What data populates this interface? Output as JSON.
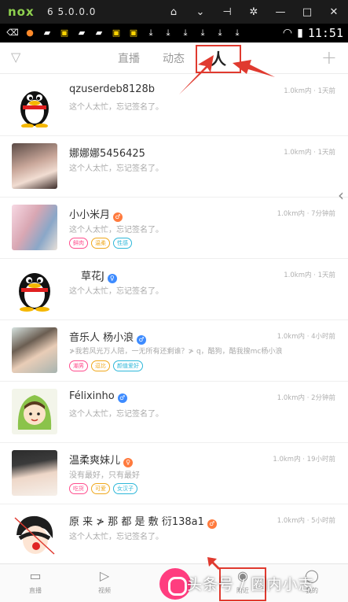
{
  "emulator": {
    "logo": "nox",
    "version": "6 5.0.0.0",
    "controls": [
      "home-icon",
      "chevron-down-icon",
      "pin-icon",
      "settings-icon",
      "minimize-icon",
      "maximize-icon",
      "close-icon"
    ]
  },
  "status_bar": {
    "time": "11:51"
  },
  "header": {
    "tabs": [
      {
        "label": "直播"
      },
      {
        "label": "动态"
      },
      {
        "label": "人"
      }
    ],
    "plus_label": "+"
  },
  "users": [
    {
      "name": "qzuserdeb8128b",
      "signature": "这个人太忙，忘记签名了。",
      "meta": "1.0km内 · 1天前",
      "badge": "",
      "tags": []
    },
    {
      "name": "娜娜娜5456425",
      "signature": "这个人太忙，忘记签名了。",
      "meta": "1.0km内 · 1天前",
      "badge": "",
      "tags": []
    },
    {
      "name": "小小米月",
      "signature": "这个人太忙，忘记签名了。",
      "meta": "1.0km内 · 7分钟前",
      "badge": "orange",
      "tags": [
        {
          "label": "鲜肉",
          "color": "#ff4d8d"
        },
        {
          "label": "温柔",
          "color": "#f0a81c"
        },
        {
          "label": "性感",
          "color": "#2db7d9"
        }
      ]
    },
    {
      "name": "草花J",
      "signature": "这个人太忙，忘记签名了。",
      "meta": "1.0km内 · 1天前",
      "badge": "blue",
      "tags": []
    },
    {
      "name": "音乐人 杨小浪",
      "signature": "≯我若风光万人陪，一无所有还剩谁？≯ q，酷狗，酷我搜mc杨小浪",
      "meta": "1.0km内 · 4小时前",
      "badge": "blue",
      "tags": [
        {
          "label": "潮男",
          "color": "#ff4d8d"
        },
        {
          "label": "逗比",
          "color": "#f0a81c"
        },
        {
          "label": "颜值爱好",
          "color": "#2db7d9"
        }
      ]
    },
    {
      "name": "Félixinho",
      "signature": "这个人太忙，忘记签名了。",
      "meta": "1.0km内 · 2分钟前",
      "badge": "blue",
      "tags": []
    },
    {
      "name": "温柔爽妹儿",
      "signature": "没有最好，只有最好",
      "meta": "1.0km内 · 19小时前",
      "badge": "orange",
      "tags": [
        {
          "label": "吃货",
          "color": "#ff4d8d"
        },
        {
          "label": "可爱",
          "color": "#f0a81c"
        },
        {
          "label": "女汉子",
          "color": "#2db7d9"
        }
      ]
    },
    {
      "name": "原 来 ≯ 那 都 是 敷 衍138a1",
      "signature": "这个人太忙，忘记签名了。",
      "meta": "1.0km内 · 5小时前",
      "badge": "orange",
      "tags": []
    }
  ],
  "bottom_nav": [
    {
      "label": "直播",
      "icon": "tv-icon"
    },
    {
      "label": "视频",
      "icon": "play-icon"
    },
    {
      "label": "附近",
      "icon": "location-icon"
    },
    {
      "label": "我的",
      "icon": "user-icon"
    }
  ],
  "watermark": "头条号 / 圈内小志",
  "colors": {
    "annotation_red": "#e03a2f",
    "brand_pink": "#ff3d7f",
    "emulator_green": "#8fd14f"
  }
}
